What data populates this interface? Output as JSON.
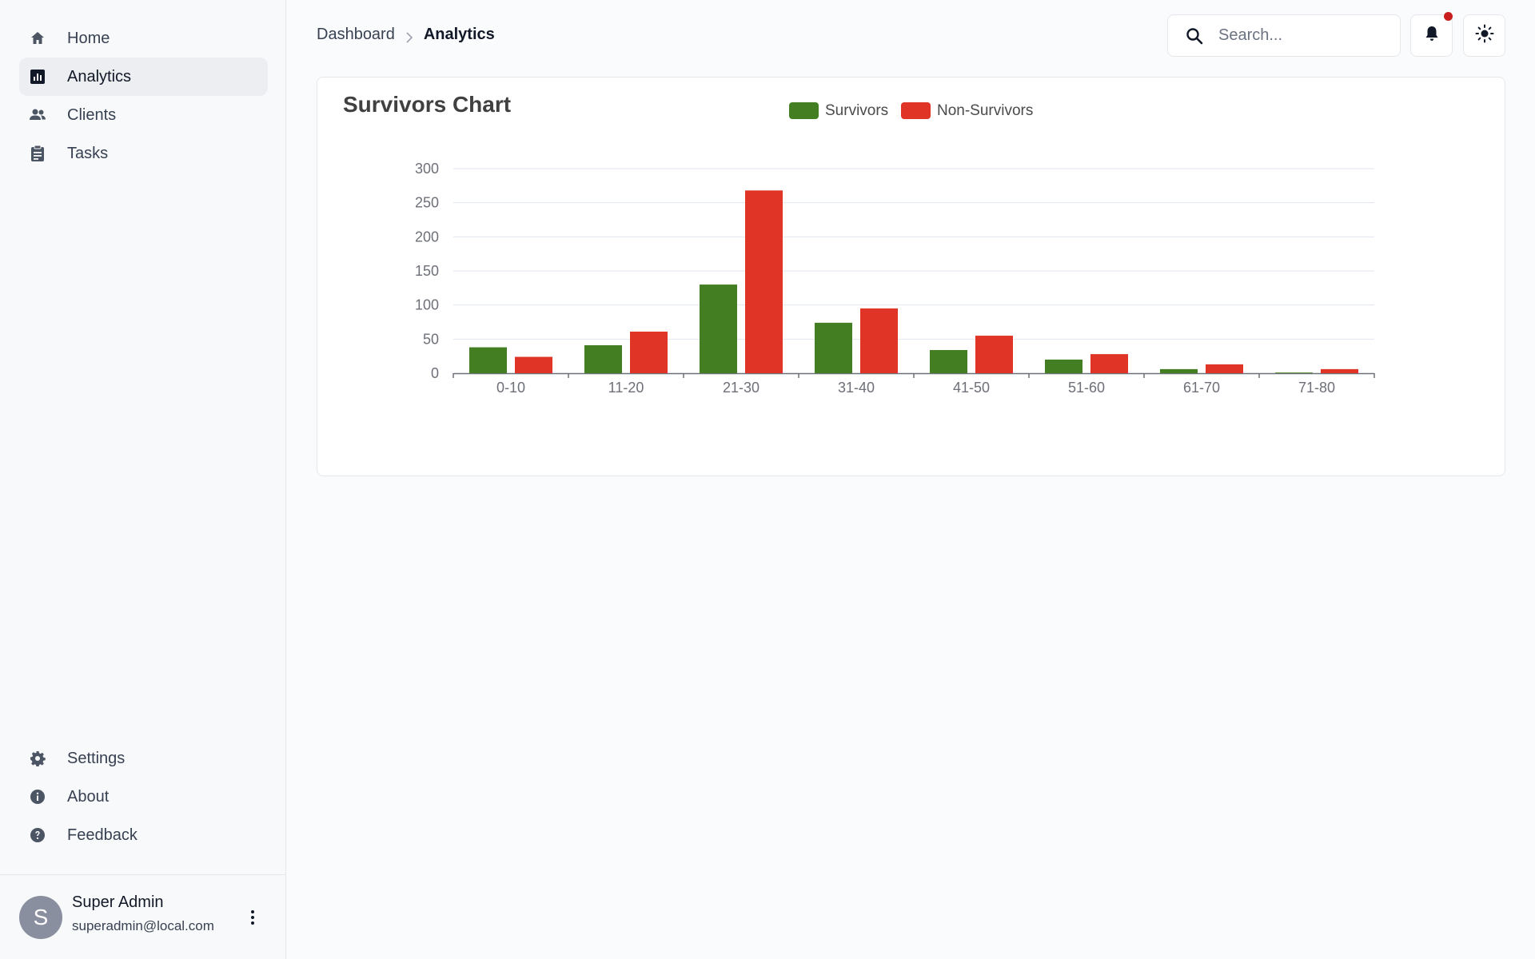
{
  "sidebar": {
    "items": [
      {
        "label": "Home",
        "icon": "home-icon",
        "active": false
      },
      {
        "label": "Analytics",
        "icon": "analytics-icon",
        "active": true
      },
      {
        "label": "Clients",
        "icon": "users-icon",
        "active": false
      },
      {
        "label": "Tasks",
        "icon": "clipboard-icon",
        "active": false
      }
    ],
    "bottom_items": [
      {
        "label": "Settings",
        "icon": "gear-icon"
      },
      {
        "label": "About",
        "icon": "info-icon"
      },
      {
        "label": "Feedback",
        "icon": "help-icon"
      }
    ],
    "user": {
      "initial": "S",
      "name": "Super Admin",
      "email": "superadmin@local.com"
    }
  },
  "header": {
    "breadcrumb": [
      "Dashboard",
      "Analytics"
    ],
    "search_placeholder": "Search...",
    "has_notification": true
  },
  "colors": {
    "survivors": "#437f22",
    "non_survivors": "#e03526"
  },
  "chart_data": {
    "type": "bar",
    "title": "Survivors Chart",
    "categories": [
      "0-10",
      "11-20",
      "21-30",
      "31-40",
      "41-50",
      "51-60",
      "61-70",
      "71-80"
    ],
    "series": [
      {
        "name": "Survivors",
        "values": [
          38,
          41,
          130,
          74,
          34,
          20,
          6,
          1
        ]
      },
      {
        "name": "Non-Survivors",
        "values": [
          24,
          61,
          268,
          95,
          55,
          28,
          13,
          6
        ]
      }
    ],
    "ylim": [
      0,
      300
    ],
    "yticks": [
      0,
      50,
      100,
      150,
      200,
      250,
      300
    ],
    "legend": "top",
    "grid": true
  }
}
